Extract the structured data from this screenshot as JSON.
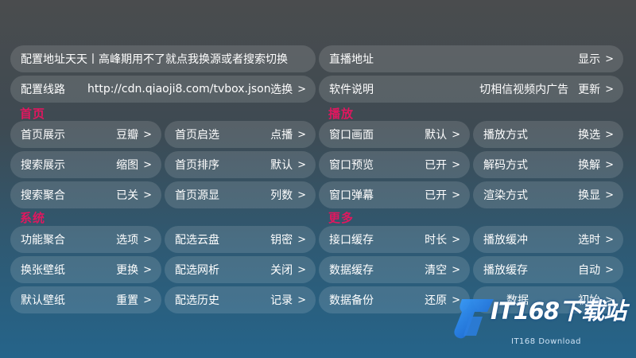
{
  "top_rows": [
    {
      "label": "配置地址天天丨高峰期用不了就点我换源或者搜索切换",
      "value": ""
    },
    {
      "label": "直播地址",
      "value": "显示"
    },
    {
      "label": "配置线路",
      "middle": "http://cdn.qiaoji8.com/tvbox.json",
      "value": "选换"
    },
    {
      "label": "软件说明",
      "ticker": "切相信视频内广告",
      "value": "更新"
    }
  ],
  "sections": {
    "home": "首页",
    "playback": "播放",
    "system": "系统",
    "more": "更多"
  },
  "home_items": [
    {
      "label": "首页展示",
      "value": "豆瓣"
    },
    {
      "label": "首页启选",
      "value": "点播"
    },
    {
      "label": "搜索展示",
      "value": "缩图"
    },
    {
      "label": "首页排序",
      "value": "默认"
    },
    {
      "label": "搜索聚合",
      "value": "已关"
    },
    {
      "label": "首页源显",
      "value": "列数"
    }
  ],
  "playback_items": [
    {
      "label": "窗口画面",
      "value": "默认"
    },
    {
      "label": "播放方式",
      "value": "换选"
    },
    {
      "label": "窗口预览",
      "value": "已开"
    },
    {
      "label": "解码方式",
      "value": "换解"
    },
    {
      "label": "窗口弹幕",
      "value": "已开"
    },
    {
      "label": "渲染方式",
      "value": "换显"
    }
  ],
  "system_items": [
    {
      "label": "功能聚合",
      "value": "选项"
    },
    {
      "label": "配选云盘",
      "value": "钥密"
    },
    {
      "label": "换张壁纸",
      "value": "更换"
    },
    {
      "label": "配选网析",
      "value": "关闭"
    },
    {
      "label": "默认壁纸",
      "value": "重置"
    },
    {
      "label": "配选历史",
      "value": "记录"
    }
  ],
  "more_items": [
    {
      "label": "接口缓存",
      "value": "时长"
    },
    {
      "label": "播放缓冲",
      "value": "选时"
    },
    {
      "label": "数据缓存",
      "value": "清空"
    },
    {
      "label": "播放缓存",
      "value": "自动"
    },
    {
      "label": "数据备份",
      "value": "还原"
    },
    {
      "label": "数据",
      "value": "初始"
    }
  ],
  "chevron": ">",
  "watermark": {
    "brand": "IT168下载站",
    "sub": "IT168 Download"
  },
  "colors": {
    "section_accent": "#e0175f"
  }
}
